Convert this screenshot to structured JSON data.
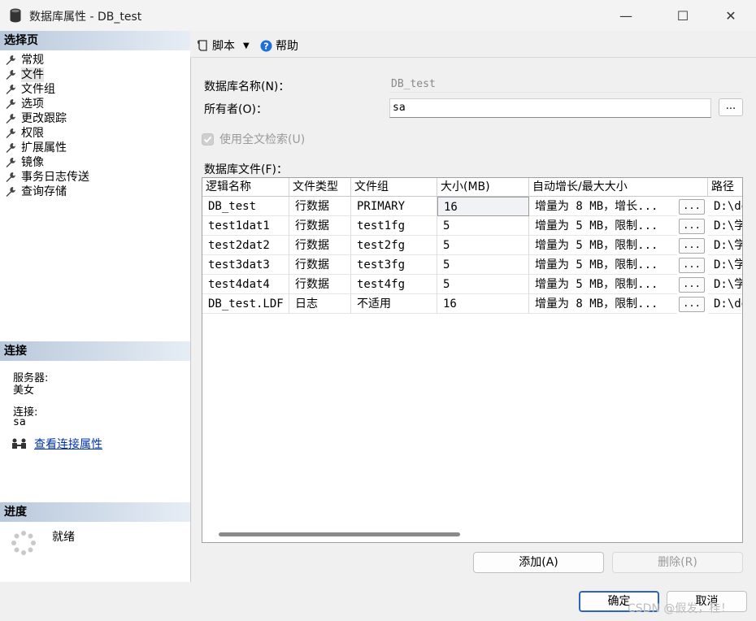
{
  "window": {
    "title": "数据库属性 - DB_test",
    "controls": {
      "minimize": "—",
      "maximize": "☐",
      "close": "✕"
    }
  },
  "left_panel": {
    "select_page_header": "选择页",
    "nav_items": [
      {
        "label": "常规",
        "icon": "wrench-icon"
      },
      {
        "label": "文件",
        "icon": "wrench-icon",
        "selected": true
      },
      {
        "label": "文件组",
        "icon": "wrench-icon"
      },
      {
        "label": "选项",
        "icon": "wrench-icon"
      },
      {
        "label": "更改跟踪",
        "icon": "wrench-icon"
      },
      {
        "label": "权限",
        "icon": "wrench-icon"
      },
      {
        "label": "扩展属性",
        "icon": "wrench-icon"
      },
      {
        "label": "镜像",
        "icon": "wrench-icon"
      },
      {
        "label": "事务日志传送",
        "icon": "wrench-icon"
      },
      {
        "label": "查询存储",
        "icon": "wrench-icon"
      }
    ],
    "connection_header": "连接",
    "server_label": "服务器:",
    "server_value": "美女",
    "connection_label": "连接:",
    "connection_value": "sa",
    "view_connection_link": "查看连接属性",
    "progress_header": "进度",
    "progress_status": "就绪"
  },
  "toolbar": {
    "script_label": "脚本",
    "help_label": "帮助"
  },
  "form": {
    "db_name_label": "数据库名称(N)：",
    "db_name_value": "DB_test",
    "owner_label": "所有者(O)：",
    "owner_value": "sa",
    "owner_browse": "...",
    "fulltext_label": "使用全文检索(U)",
    "fulltext_checked": true,
    "db_files_label": "数据库文件(F)："
  },
  "files_table": {
    "columns": [
      "逻辑名称",
      "文件类型",
      "文件组",
      "大小(MB)",
      "自动增长/最大大小",
      "路径"
    ],
    "rows": [
      {
        "name": "DB_test",
        "type": "行数据",
        "group": "PRIMARY",
        "size": "16",
        "growth": "增量为 8 MB，增长...",
        "btn": "...",
        "path": "D:\\de"
      },
      {
        "name": "test1dat1",
        "type": "行数据",
        "group": "test1fg",
        "size": "5",
        "growth": "增量为 5 MB，限制...",
        "btn": "...",
        "path": "D:\\学"
      },
      {
        "name": "test2dat2",
        "type": "行数据",
        "group": "test2fg",
        "size": "5",
        "growth": "增量为 5 MB，限制...",
        "btn": "...",
        "path": "D:\\学"
      },
      {
        "name": "test3dat3",
        "type": "行数据",
        "group": "test3fg",
        "size": "5",
        "growth": "增量为 5 MB，限制...",
        "btn": "...",
        "path": "D:\\学"
      },
      {
        "name": "test4dat4",
        "type": "行数据",
        "group": "test4fg",
        "size": "5",
        "growth": "增量为 5 MB，限制...",
        "btn": "...",
        "path": "D:\\学"
      },
      {
        "name": "DB_test.LDF",
        "type": "日志",
        "group": "不适用",
        "size": "16",
        "growth": "增量为 8 MB，限制...",
        "btn": "...",
        "path": "D:\\de"
      }
    ]
  },
  "buttons": {
    "add": "添加(A)",
    "remove": "删除(R)",
    "ok": "确定",
    "cancel": "取消"
  },
  "watermark": "CSDN @假发，桂！"
}
